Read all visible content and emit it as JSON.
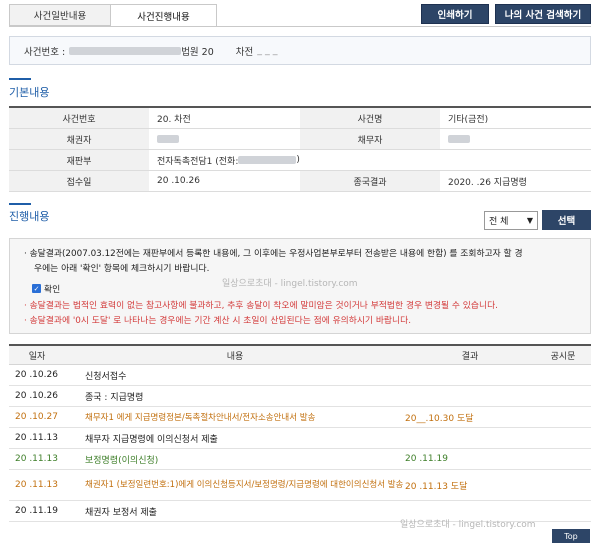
{
  "tabs": [
    {
      "label": "사건일반내용",
      "active": false
    },
    {
      "label": "사건진행내용",
      "active": true
    }
  ],
  "actions": {
    "print": "인쇄하기",
    "my_search": "나의 사건 검색하기"
  },
  "case_header": {
    "prefix": "사건번호 :",
    "court_suffix": "법원 20",
    "type_label": "차전"
  },
  "basic": {
    "title": "기본내용",
    "rows": [
      {
        "l1": "사건번호",
        "v1": "20.  차전",
        "l2": "사건명",
        "v2": "기타(금전)"
      },
      {
        "l1": "채권자",
        "v1": "",
        "l2": "채무자",
        "v2": ""
      },
      {
        "l1": "재판부",
        "v1": "전자독촉전담1 (전화:",
        "v1_tail": ")",
        "l2": "",
        "v2": ""
      },
      {
        "l1": "접수일",
        "v1": "20     .10.26",
        "l2": "종국결과",
        "v2": "2020.    .26 지급명령"
      }
    ]
  },
  "progress": {
    "title": "진행내용",
    "filter": {
      "selected": "전 체",
      "button": "선택"
    },
    "notice": {
      "line1": "· 송달결과(2007.03.12전에는 재판부에서 등록한 내용에, 그 이후에는 우정사업본부로부터 전송받은 내용에 한함) 를 조회하고자 할 경",
      "line2": "우에는 아래 '확인' 항목에 체크하시기 바랍니다.",
      "check_label": "확인",
      "line3": "· 송달결과는 법적인 효력이 없는 참고사항에 불과하고, 추후 송달이 착오에 말미암은 것이거나 부적법한 경우 변경될 수 있습니다.",
      "line4": "· 송달결과에 '0시 도달' 로 나타나는 경우에는 기간 계산 시 초일이 산입된다는 점에 유의하시기 바랍니다."
    },
    "headers": {
      "date": "일자",
      "content": "내용",
      "result": "결과",
      "pub": "공시문"
    },
    "rows": [
      {
        "date": "20   .10.26",
        "content": "신청서접수",
        "result": "",
        "style": "normal"
      },
      {
        "date": "20   .10.26",
        "content": "종국 : 지급명령",
        "result": "",
        "style": "normal"
      },
      {
        "date": "20   .10.27",
        "content": "채무자1       에게 지급명령정본/독촉절차안내서/전자소송안내서 발송",
        "result": "20__.10.30 도달",
        "style": "orange"
      },
      {
        "date": "20   .11.13",
        "content": "채무자       지급명령에 이의신청서 제출",
        "result": "",
        "style": "normal"
      },
      {
        "date": "20   .11.13",
        "content": "보정명령(이의신청)",
        "result": "20     .11.19",
        "style": "green"
      },
      {
        "date": "20   .11.13",
        "content": "채권자1       (보정일련번호:1)에게 이의신청등지서/보정명령/지급명령에 대한이의신청서 발송",
        "result": "20     .11.13 도달",
        "style": "orange"
      },
      {
        "date": "20   .11.19",
        "content": "채권자       보정서 제출",
        "result": "",
        "style": "normal"
      }
    ]
  },
  "watermark": {
    "text1": "일상으로초대  -  lingel.tistory.com",
    "text2": "일상으로초대 - lingel.tistory.com"
  },
  "top_button": "Top"
}
